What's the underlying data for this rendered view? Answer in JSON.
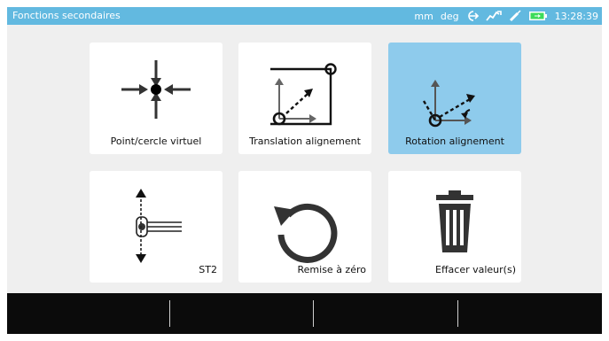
{
  "status_bar": {
    "title": "Fonctions secondaires",
    "unit_length": "mm",
    "unit_angle": "deg",
    "time": "13:28:39",
    "icons": [
      "login-arrow-icon",
      "signal-graph-icon",
      "laser-icon",
      "battery-icon"
    ],
    "colors": {
      "background": "#62b9e0",
      "text": "#ffffff",
      "battery": "#3ddc5a"
    }
  },
  "tiles": [
    {
      "label": "Point/cercle virtuel",
      "icon": "virtual-point-icon",
      "selected": false
    },
    {
      "label": "Translation alignement",
      "icon": "translation-alignment-icon",
      "selected": false
    },
    {
      "label": "Rotation alignement",
      "icon": "rotation-alignment-icon",
      "selected": true
    },
    {
      "label": "ST2",
      "icon": "st2-icon",
      "selected": false
    },
    {
      "label": "Remise à zéro",
      "icon": "reset-icon",
      "selected": false
    },
    {
      "label": "Effacer valeur(s)",
      "icon": "trash-icon",
      "selected": false
    }
  ],
  "colors": {
    "selected_tile": "#8ecbec",
    "tile": "#ffffff",
    "panel": "#efefef",
    "icon": "#333333"
  },
  "bottom_bar": {
    "soft_key_count": 4
  }
}
